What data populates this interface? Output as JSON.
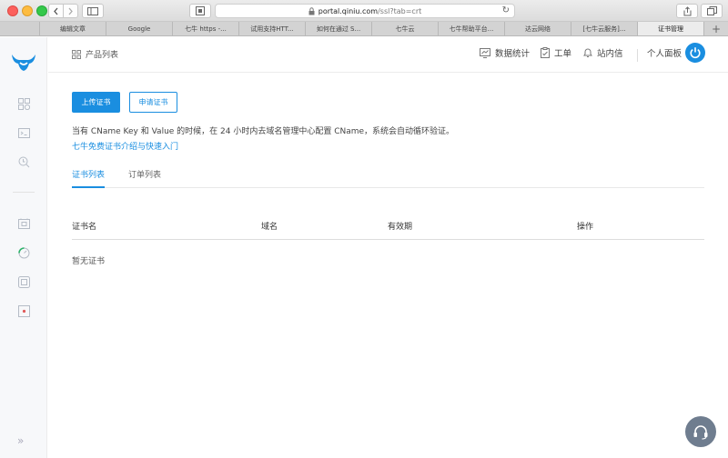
{
  "browser": {
    "url_host": "portal.qiniu.com",
    "url_path": "/ssl?tab=crt",
    "tabs": [
      {
        "label": "编辑文章",
        "active": false
      },
      {
        "label": "Google",
        "active": false
      },
      {
        "label": "七牛 https -...",
        "active": false
      },
      {
        "label": "试用支持HTT...",
        "active": false
      },
      {
        "label": "如何在通过 S...",
        "active": false
      },
      {
        "label": "七牛云",
        "active": false
      },
      {
        "label": "七牛帮助平台...",
        "active": false
      },
      {
        "label": "达云网络",
        "active": false
      },
      {
        "label": "[七牛云服务]...",
        "active": false
      },
      {
        "label": "证书管理",
        "active": true
      }
    ],
    "new_tab_label": "+"
  },
  "header": {
    "product_list": "产品列表",
    "stats": "数据统计",
    "ticket": "工单",
    "messages": "站内信",
    "panel": "个人面板"
  },
  "main": {
    "upload_button": "上传证书",
    "apply_button": "申请证书",
    "notice": "当有 CName Key 和 Value 的时候，在 24 小时内去域名管理中心配置 CName，系统会自动循环验证。",
    "guide_link": "七牛免费证书介绍与快速入门",
    "tabs": [
      {
        "label": "证书列表",
        "active": true
      },
      {
        "label": "订单列表",
        "active": false
      }
    ],
    "table": {
      "columns": [
        "证书名",
        "域名",
        "有效期",
        "操作"
      ],
      "empty_text": "暂无证书"
    }
  },
  "colors": {
    "accent": "#1a8ee0",
    "rail_bg": "#f7f8fa"
  },
  "icons": {
    "rail": [
      "qiniu-logo-icon",
      "apps-icon",
      "terminal-icon",
      "search-doc-icon",
      "storage-icon",
      "cdn-icon",
      "cube-icon",
      "media-icon",
      "expand-icon"
    ]
  }
}
